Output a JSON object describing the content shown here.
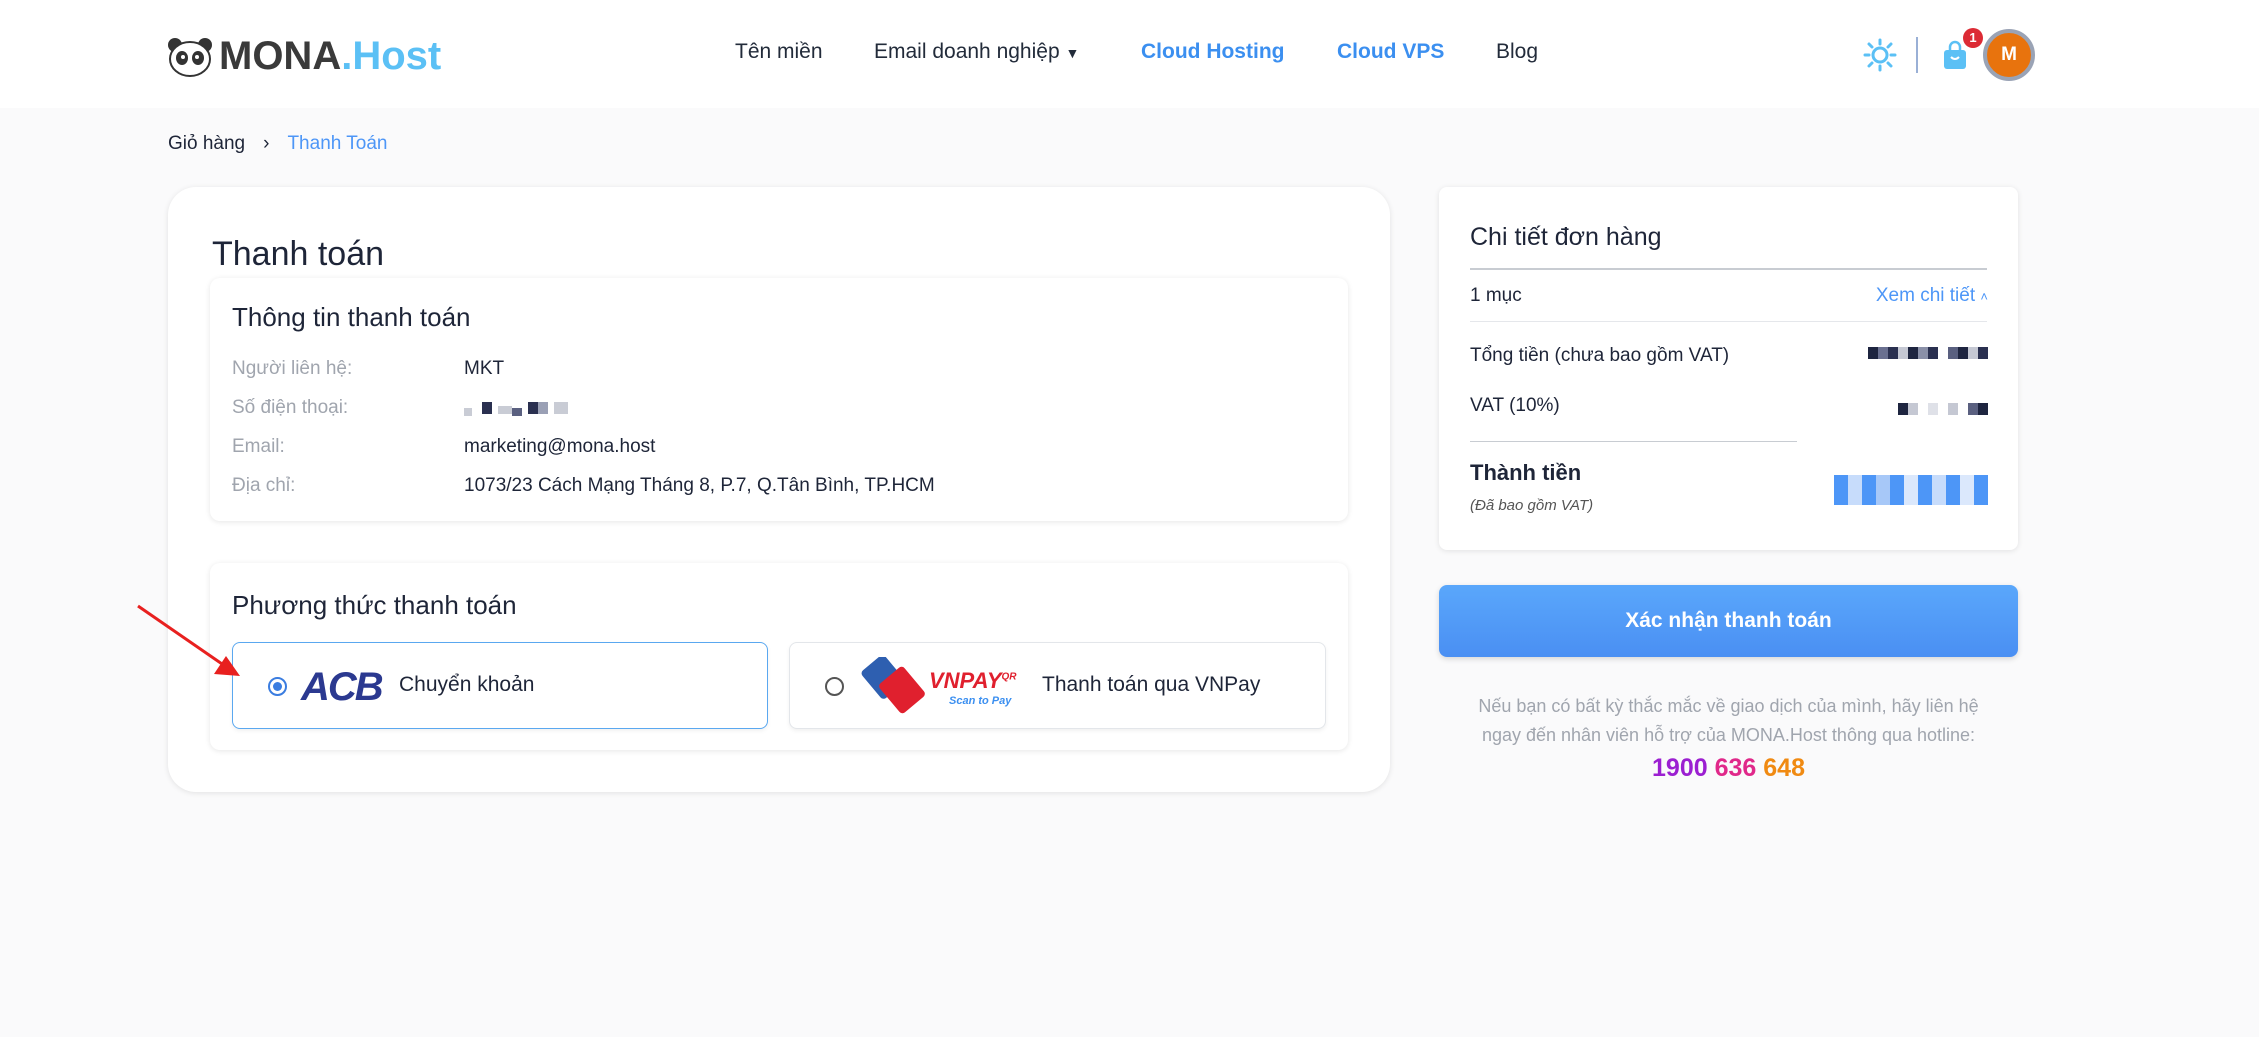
{
  "header": {
    "logo_main": "MONA",
    "logo_accent": ".Host",
    "nav": [
      {
        "label": "Tên miền"
      },
      {
        "label": "Email doanh nghiệp"
      },
      {
        "label": "Cloud Hosting"
      },
      {
        "label": "Cloud VPS"
      },
      {
        "label": "Blog"
      }
    ],
    "cart_count": "1",
    "avatar_initial": "M"
  },
  "breadcrumb": {
    "items": [
      "Giỏ hàng",
      "Thanh Toán"
    ],
    "separator": "›"
  },
  "main": {
    "title": "Thanh toán",
    "info": {
      "title": "Thông tin thanh toán",
      "rows": [
        {
          "label": "Người liên hệ:",
          "value": "MKT"
        },
        {
          "label": "Số điện thoại:",
          "value": ""
        },
        {
          "label": "Email:",
          "value": "marketing@mona.host"
        },
        {
          "label": "Địa chỉ:",
          "value": "1073/23 Cách Mạng Tháng 8, P.7, Q.Tân Bình, TP.HCM"
        }
      ]
    },
    "payment": {
      "title": "Phương thức thanh toán",
      "options": [
        {
          "logo": "ACB",
          "label": "Chuyển khoản",
          "selected": true
        },
        {
          "logo": "VNPAY",
          "logo_sup": "QR",
          "logo_sub": "Scan to Pay",
          "label": "Thanh toán qua VNPay",
          "selected": false
        }
      ]
    }
  },
  "summary": {
    "title": "Chi tiết đơn hàng",
    "items_count": "1 mục",
    "view_details": "Xem chi tiết",
    "subtotal_label": "Tổng tiền (chưa bao gồm VAT)",
    "vat_label": "VAT (10%)",
    "total_label": "Thành tiền",
    "total_note": "(Đã bao gồm VAT)"
  },
  "confirm_button": "Xác nhận thanh toán",
  "help": {
    "line1": "Nếu bạn có bất kỳ thắc mắc về giao dịch của mình, hãy liên hệ",
    "line2": "ngay đến nhân viên hỗ trợ của MONA.Host thông qua hotline:",
    "hotline": [
      "1900",
      "636",
      "648"
    ],
    "hotline_colors": [
      "#9b1fd1",
      "#e0288a",
      "#f08a12"
    ]
  },
  "colors": {
    "accent": "#3b8ff0",
    "button": "#4d96f7",
    "avatar": "#e8730d"
  }
}
